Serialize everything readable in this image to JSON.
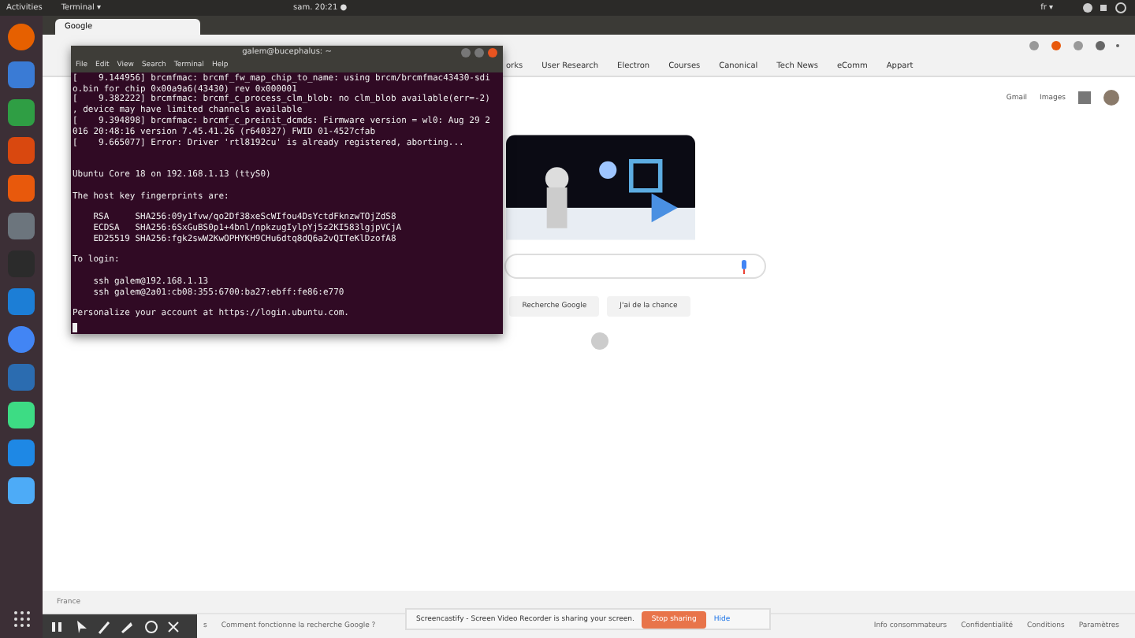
{
  "top_bar": {
    "activities": "Activities",
    "app_menu": "Terminal ▾",
    "clock": "sam. 20:21 ●",
    "input_source": "fr ▾"
  },
  "dock": {
    "apps": [
      {
        "kind": "firefox"
      },
      {
        "kind": "writer"
      },
      {
        "kind": "calc"
      },
      {
        "kind": "impress"
      },
      {
        "kind": "software"
      },
      {
        "kind": "settings"
      },
      {
        "kind": "terminal"
      },
      {
        "kind": "share"
      },
      {
        "kind": "chrome"
      },
      {
        "kind": "code"
      },
      {
        "kind": "android"
      },
      {
        "kind": "k"
      },
      {
        "kind": "draw"
      }
    ]
  },
  "browser": {
    "tab": {
      "title": "Google"
    },
    "bookmarks": [
      "orks",
      "User Research",
      "Electron",
      "Courses",
      "Canonical",
      "Tech News",
      "eComm",
      "Appart"
    ],
    "page": {
      "header_links": [
        "Gmail",
        "Images"
      ],
      "buttons": [
        "Recherche Google",
        "J'ai de la chance"
      ],
      "country": "France",
      "footer_left": [
        "s",
        "Comment fonctionne la recherche Google ?"
      ],
      "footer_right": [
        "Info consommateurs",
        "Confidentialité",
        "Conditions",
        "Paramètres"
      ]
    }
  },
  "terminal": {
    "title": "galem@bucephalus: ~",
    "menu": [
      "File",
      "Edit",
      "View",
      "Search",
      "Terminal",
      "Help"
    ],
    "blocks": [
      [
        "[    9.144956] brcmfmac: brcmf_fw_map_chip_to_name: using brcm/brcmfmac43430-sdi",
        "o.bin for chip 0x00a9a6(43430) rev 0x000001",
        "[    9.382222] brcmfmac: brcmf_c_process_clm_blob: no clm_blob available(err=-2)",
        ", device may have limited channels available",
        "[    9.394898] brcmfmac: brcmf_c_preinit_dcmds: Firmware version = wl0: Aug 29 2",
        "016 20:48:16 version 7.45.41.26 (r640327) FWID 01-4527cfab",
        "[    9.665077] Error: Driver 'rtl8192cu' is already registered, aborting..."
      ],
      [
        "Ubuntu Core 18 on 192.168.1.13 (ttyS0)"
      ],
      [
        "The host key fingerprints are:"
      ],
      [
        "    RSA     SHA256:09y1fvw/qo2Df38xeScWIfou4DsYctdFknzwTOjZdS8",
        "    ECDSA   SHA256:6SxGuBS0p1+4bnl/npkzugIylpYj5z2KI583lgjpVCjA",
        "    ED25519 SHA256:fgk2swW2KwOPHYKH9CHu6dtq8dQ6a2vQITeKlDzofA8"
      ],
      [
        "To login:"
      ],
      [
        "    ssh galem@192.168.1.13",
        "    ssh galem@2a01:cb08:355:6700:ba27:ebff:fe86:e770"
      ],
      [
        "Personalize your account at https://login.ubuntu.com."
      ]
    ]
  },
  "recorder": {
    "message": "Screencastify - Screen Video Recorder is sharing your screen.",
    "stop": "Stop sharing",
    "hide": "Hide"
  }
}
